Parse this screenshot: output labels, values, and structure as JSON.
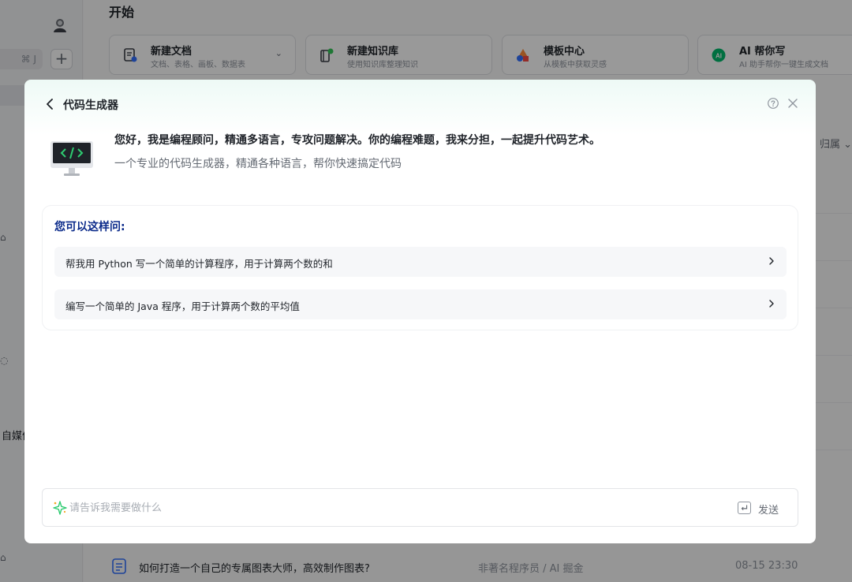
{
  "sidebar": {
    "search_shortcut": "⌘ J",
    "add_glyph": "+",
    "fragment_label": "自媒体"
  },
  "main": {
    "title": "开始",
    "quick_actions": [
      {
        "title": "新建文档",
        "subtitle": "文档、表格、画板、数据表",
        "has_dropdown": true
      },
      {
        "title": "新建知识库",
        "subtitle": "使用知识库整理知识"
      },
      {
        "title": "模板中心",
        "subtitle": "从模板中获取灵感"
      },
      {
        "title": "AI 帮你写",
        "subtitle": "AI 助手帮你一键生成文档"
      }
    ],
    "filter_label": "归属",
    "recent_doc": {
      "title": "如何打造一个自己的专属图表大师，高效制作图表?",
      "author": "非著名程序员 / AI 掘金",
      "date": "08-15 23:30"
    }
  },
  "modal": {
    "title": "代码生成器",
    "greeting": "您好，我是编程顾问，精通多语言，专攻问题解决。你的编程难题，我来分担，一起提升代码艺术。",
    "subtitle": "一个专业的代码生成器，精通各种语言，帮你快速搞定代码",
    "ask_heading": "您可以这样问:",
    "suggestions": [
      "帮我用 Python 写一个简单的计算程序，用于计算两个数的和",
      "编写一个简单的 Java 程序，用于计算两个数的平均值"
    ],
    "input_placeholder": "请告诉我需要做什么",
    "input_value": "",
    "send_label": "发送"
  }
}
